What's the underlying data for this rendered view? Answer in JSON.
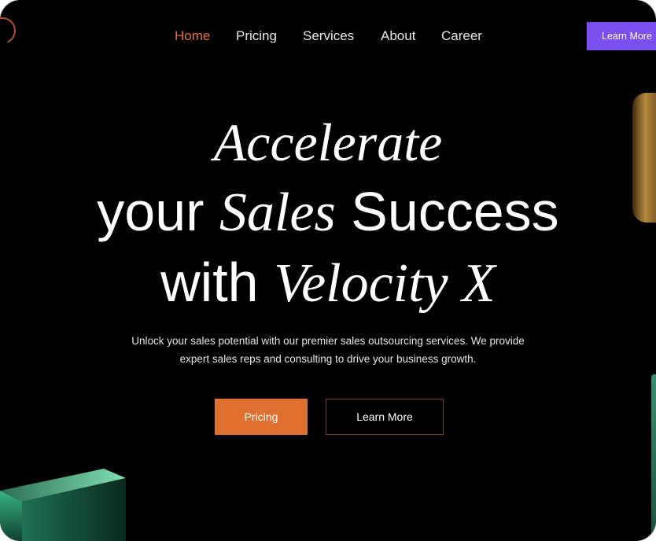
{
  "nav": {
    "items": [
      {
        "label": "Home",
        "active": true
      },
      {
        "label": "Pricing",
        "active": false
      },
      {
        "label": "Services",
        "active": false
      },
      {
        "label": "About",
        "active": false
      },
      {
        "label": "Career",
        "active": false
      }
    ],
    "cta_label": "Learn More"
  },
  "hero": {
    "line1_italic": "Accelerate",
    "line2_a": "your ",
    "line2_italic": "Sales",
    "line2_b": " Success",
    "line3_a": "with ",
    "line3_italic": "Velocity X",
    "subtitle_line1": "Unlock your sales potential with our premier sales outsourcing services. We provide",
    "subtitle_line2": "expert sales reps and consulting to drive your business growth.",
    "primary_button": "Pricing",
    "secondary_button": "Learn More"
  },
  "colors": {
    "background": "#000000",
    "accent_orange": "#e0702f",
    "nav_active": "#e26f36",
    "cta_purple": "#7a4ff0"
  }
}
